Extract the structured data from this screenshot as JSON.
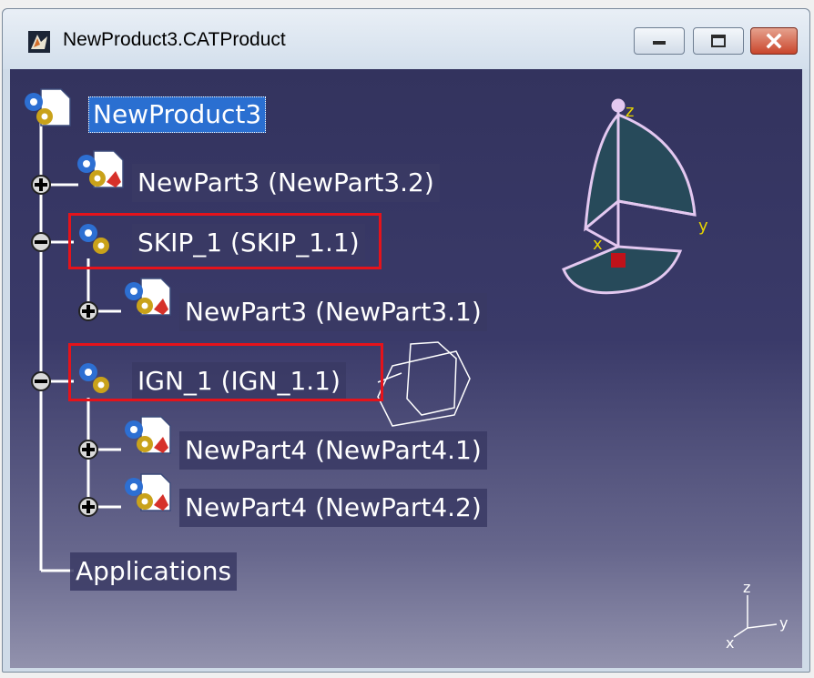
{
  "window": {
    "title": "NewProduct3.CATProduct"
  },
  "tree": {
    "root": "NewProduct3",
    "items": [
      {
        "label": "NewPart3 (NewPart3.2)",
        "expander": "+"
      },
      {
        "label": "SKIP_1 (SKIP_1.1)",
        "expander": "-"
      },
      {
        "label": "NewPart3 (NewPart3.1)",
        "expander": "+"
      },
      {
        "label": "IGN_1 (IGN_1.1)",
        "expander": "-"
      },
      {
        "label": "NewPart4 (NewPart4.1)",
        "expander": "+"
      },
      {
        "label": "NewPart4 (NewPart4.2)",
        "expander": "+"
      }
    ],
    "applications": "Applications"
  },
  "compass": {
    "z": "z",
    "y": "y",
    "x": "x"
  },
  "axis_triad": {
    "z": "z",
    "y": "y",
    "x": "x"
  },
  "colors": {
    "viewport_top": "#33335e",
    "viewport_bottom": "#9292ad",
    "highlight": "#e5131b",
    "selection": "#2a6fd1",
    "compass": "#e3c8f0"
  }
}
